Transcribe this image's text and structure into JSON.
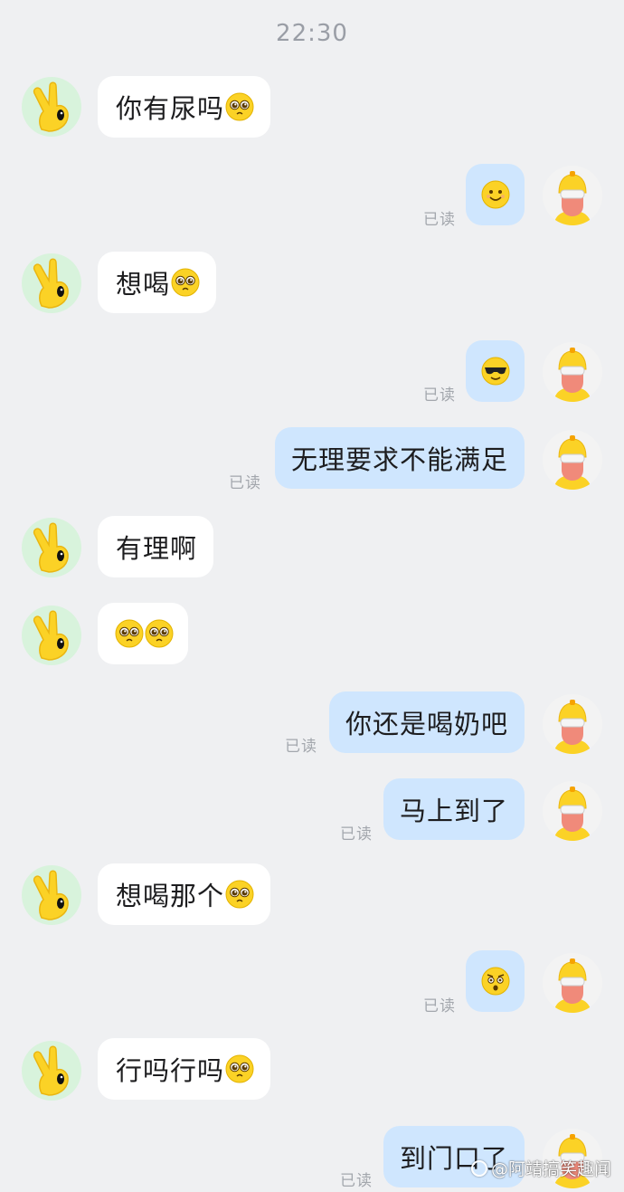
{
  "timestamp": "22:30",
  "read_label": "已读",
  "colors": {
    "background": "#eff0f2",
    "incoming_bubble": "#ffffff",
    "outgoing_bubble": "#cfe6fe",
    "emoji_yellow": "#fbd226"
  },
  "contact": {
    "avatar_icon": "yellow-hand-peace-icon"
  },
  "me": {
    "avatar_icon": "yellow-helmet-sunglasses-icon"
  },
  "messages": [
    {
      "id": 1,
      "side": "left",
      "text": "你有尿吗",
      "emoji": "pleading-face-icon"
    },
    {
      "id": 2,
      "side": "right",
      "text": "",
      "emoji": "smile-face-icon",
      "read": true
    },
    {
      "id": 3,
      "side": "left",
      "text": "想喝",
      "emoji": "pleading-face-icon"
    },
    {
      "id": 4,
      "side": "right",
      "text": "",
      "emoji": "sunglasses-face-icon",
      "read": true
    },
    {
      "id": 5,
      "side": "right",
      "text": "无理要求不能满足",
      "read": true
    },
    {
      "id": 6,
      "side": "left",
      "text": "有理啊"
    },
    {
      "id": 7,
      "side": "left",
      "text": "",
      "emoji": "pleading-face-icon",
      "emoji_count": 2
    },
    {
      "id": 8,
      "side": "right",
      "text": "你还是喝奶吧",
      "read": true
    },
    {
      "id": 9,
      "side": "right",
      "text": "马上到了",
      "read": true
    },
    {
      "id": 10,
      "side": "left",
      "text": "想喝那个",
      "emoji": "pleading-face-icon"
    },
    {
      "id": 11,
      "side": "right",
      "text": "",
      "emoji": "shocked-face-icon",
      "read": true
    },
    {
      "id": 12,
      "side": "left",
      "text": "行吗行吗",
      "emoji": "pleading-face-icon"
    },
    {
      "id": 13,
      "side": "right",
      "text": "到门口了",
      "read": true
    }
  ],
  "watermark": "@阿靖搞笑趣闻"
}
